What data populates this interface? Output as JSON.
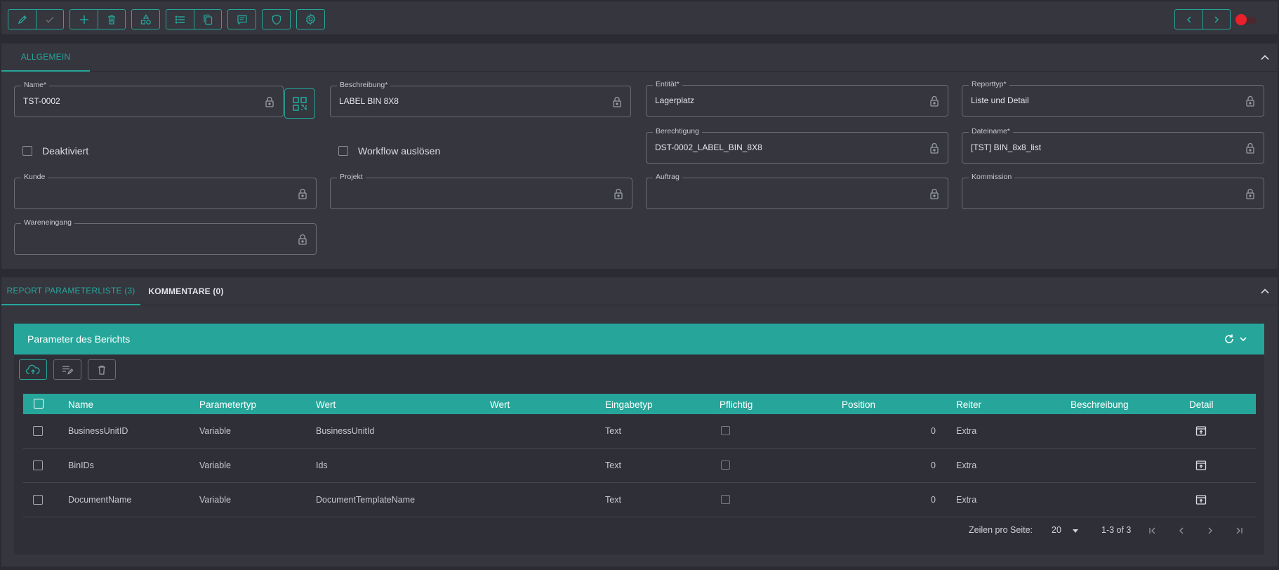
{
  "toolbar": {
    "groups": [
      {
        "buttons": [
          {
            "icon": "pencil-icon"
          },
          {
            "icon": "check-icon"
          }
        ]
      },
      {
        "buttons": [
          {
            "icon": "plus-icon"
          },
          {
            "icon": "trash-icon"
          }
        ]
      },
      {
        "buttons": [
          {
            "icon": "shapes-icon"
          }
        ]
      },
      {
        "buttons": [
          {
            "icon": "list-icon"
          },
          {
            "icon": "copy-icon"
          }
        ]
      },
      {
        "buttons": [
          {
            "icon": "comment-icon"
          }
        ]
      },
      {
        "buttons": [
          {
            "icon": "shield-icon"
          }
        ]
      },
      {
        "buttons": [
          {
            "icon": "gear-icon"
          }
        ]
      }
    ],
    "nav": {
      "prev_icon": "chevron-left-icon",
      "next_icon": "chevron-right-icon"
    },
    "toggle_color": "#e8212b"
  },
  "general": {
    "tab_label": "ALLGEMEIN",
    "fields": {
      "name": {
        "label": "Name*",
        "value": "TST-0002"
      },
      "beschreibung": {
        "label": "Beschreibung*",
        "value": "LABEL BIN 8X8"
      },
      "entitaet": {
        "label": "Entität*",
        "value": "Lagerplatz"
      },
      "reporttyp": {
        "label": "Reporttyp*",
        "value": "Liste und Detail"
      },
      "berechtigung": {
        "label": "Berechtigung",
        "value": "DST-0002_LABEL_BIN_8X8"
      },
      "dateiname": {
        "label": "Dateiname*",
        "value": "[TST] BIN_8x8_list"
      },
      "kunde": {
        "label": "Kunde",
        "value": ""
      },
      "projekt": {
        "label": "Projekt",
        "value": ""
      },
      "auftrag": {
        "label": "Auftrag",
        "value": ""
      },
      "kommission": {
        "label": "Kommission",
        "value": ""
      },
      "wareneingang": {
        "label": "Wareneingang",
        "value": ""
      }
    },
    "checkboxes": {
      "deaktiviert": "Deaktiviert",
      "workflow": "Workflow auslösen"
    }
  },
  "detail_tabs": {
    "params_tab": "REPORT PARAMETERLISTE (3)",
    "comments_tab": "KOMMENTARE (0)"
  },
  "params_card": {
    "title": "Parameter des Berichts",
    "columns": {
      "name": "Name",
      "parametertyp": "Parametertyp",
      "wert": "Wert",
      "wert2": "Wert",
      "eingabetyp": "Eingabetyp",
      "pflichtig": "Pflichtig",
      "position": "Position",
      "reiter": "Reiter",
      "beschreibung": "Beschreibung",
      "detail": "Detail"
    },
    "rows": [
      {
        "name": "BusinessUnitID",
        "parametertyp": "Variable",
        "wert": "BusinessUnitId",
        "eingabetyp": "Text",
        "position": "0",
        "reiter": "Extra"
      },
      {
        "name": "BinIDs",
        "parametertyp": "Variable",
        "wert": "Ids",
        "eingabetyp": "Text",
        "position": "0",
        "reiter": "Extra"
      },
      {
        "name": "DocumentName",
        "parametertyp": "Variable",
        "wert": "DocumentTemplateName",
        "eingabetyp": "Text",
        "position": "0",
        "reiter": "Extra"
      }
    ],
    "pagination": {
      "rows_label": "Zeilen pro Seite:",
      "rows_value": "20",
      "range": "1-3 of 3"
    }
  },
  "colors": {
    "accent": "#26a69a",
    "background": "#2b2c33",
    "panel": "#35363e"
  }
}
